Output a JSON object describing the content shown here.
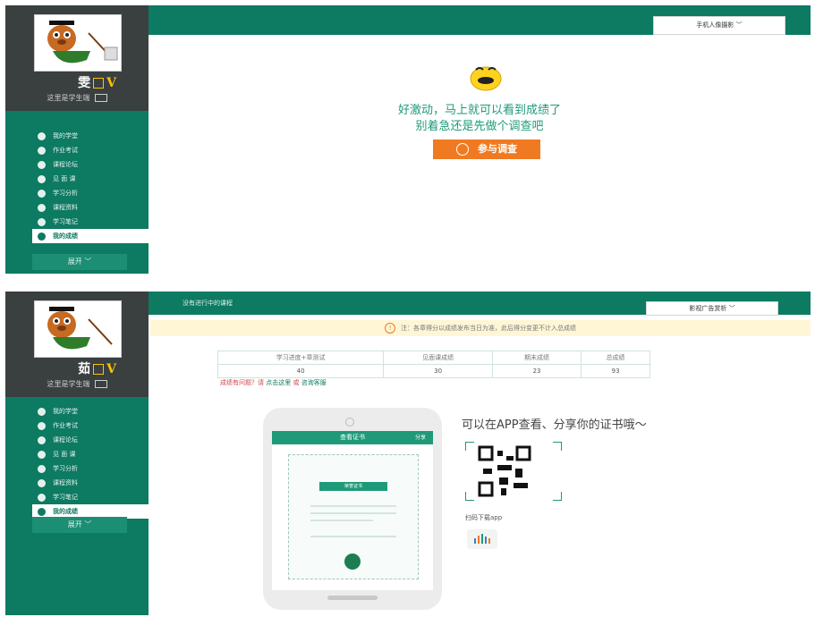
{
  "screen1": {
    "user": {
      "name_char": "雯",
      "vip": "V",
      "subtitle": "这里是学生端"
    },
    "menu": [
      {
        "label": "我的学堂",
        "icon": "home-icon",
        "active": false
      },
      {
        "label": "作业考试",
        "icon": "pencil-icon",
        "active": false
      },
      {
        "label": "课程论坛",
        "icon": "chat-icon",
        "active": false
      },
      {
        "label": "见 面 课",
        "icon": "meeting-icon",
        "active": false
      },
      {
        "label": "学习分析",
        "icon": "analysis-icon",
        "active": false
      },
      {
        "label": "课程资料",
        "icon": "folder-icon",
        "active": false
      },
      {
        "label": "学习笔记",
        "icon": "note-icon",
        "active": false
      },
      {
        "label": "我的成绩",
        "icon": "check-icon",
        "active": true
      }
    ],
    "expand_label": "展开 ﹀",
    "course_select": "手机人像摄影 ﹀",
    "message_line1": "好激动，马上就可以看到成绩了",
    "message_line2": "别着急还是先做个调查吧",
    "survey_button": "参与调查"
  },
  "screen2": {
    "user": {
      "name_char": "茹",
      "vip": "V",
      "subtitle": "这里是学生端"
    },
    "menu": [
      {
        "label": "我的学堂",
        "icon": "home-icon",
        "active": false
      },
      {
        "label": "作业考试",
        "icon": "pencil-icon",
        "active": false
      },
      {
        "label": "课程论坛",
        "icon": "chat-icon",
        "active": false
      },
      {
        "label": "见 面 课",
        "icon": "meeting-icon",
        "active": false
      },
      {
        "label": "学习分析",
        "icon": "analysis-icon",
        "active": false
      },
      {
        "label": "课程资料",
        "icon": "folder-icon",
        "active": false
      },
      {
        "label": "学习笔记",
        "icon": "note-icon",
        "active": false
      },
      {
        "label": "我的成绩",
        "icon": "check-icon",
        "active": true
      }
    ],
    "expand_label": "展开 ﹀",
    "no_course": "没有进行中的课程",
    "course_select": "影视广告赏析 ﹀",
    "notice": "注：各章得分以成绩发布当日为准，此后得分变更不计入总成绩",
    "table": {
      "headers": [
        "学习进度+章测试",
        "见面课成绩",
        "期末成绩",
        "总成绩"
      ],
      "values": [
        "40",
        "30",
        "23",
        "93"
      ]
    },
    "issue_text": "成绩有问题？请",
    "issue_link": "点击这里",
    "issue_or": "或",
    "issue_link2": "咨询客服",
    "phone_header": "查看证书",
    "phone_share": "分享",
    "cert_ribbon": "荣誉证书",
    "app_title": "可以在APP查看、分享你的证书哦～",
    "qr_caption": "扫码下载app"
  },
  "colors": {
    "brand_green": "#0d7a62",
    "accent_orange": "#f07a21",
    "text_green": "#1e9a79"
  }
}
